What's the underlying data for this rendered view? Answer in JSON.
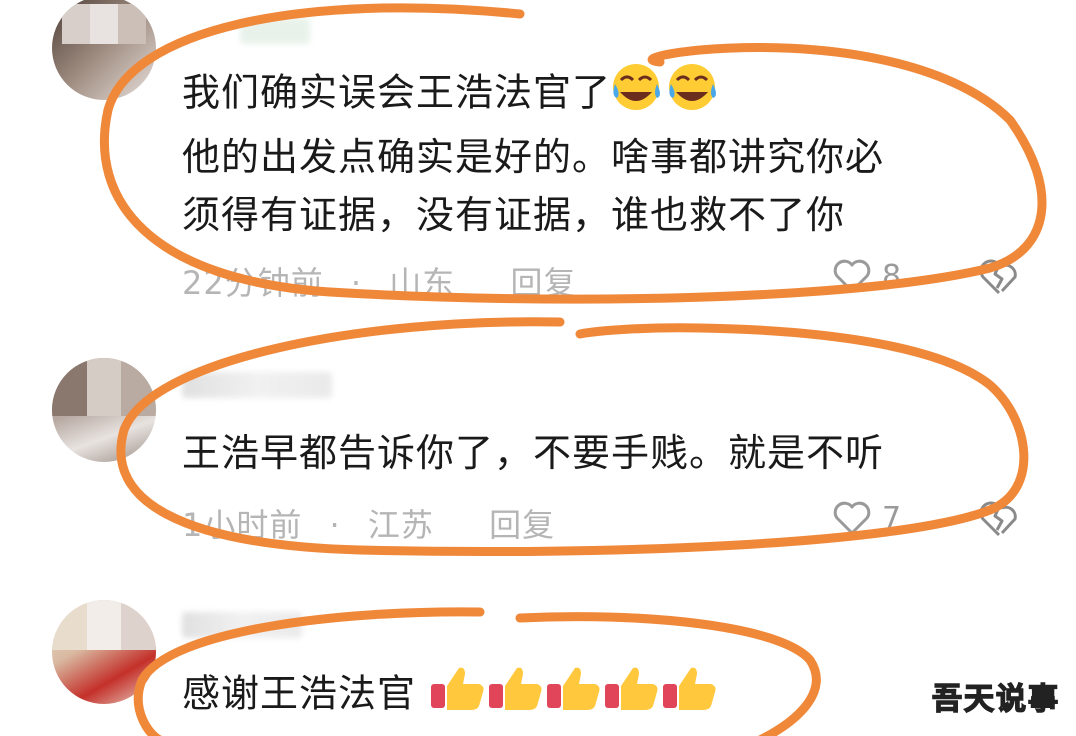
{
  "comments": [
    {
      "text_lines": [
        "我们确实误会王浩法官了",
        "他的出发点确实是好的。啥事都讲究你必",
        "须得有证据，没有证据，谁也救不了你"
      ],
      "emoji": "face-with-tears-of-joy",
      "time": "22分钟前",
      "separator": "·",
      "location": "山东",
      "reply": "回复",
      "likes": "8"
    },
    {
      "text_lines": [
        "王浩早都告诉你了，不要手贱。就是不听"
      ],
      "time": "1小时前",
      "separator": "·",
      "location": "江苏",
      "reply": "回复",
      "likes": "7"
    },
    {
      "text_lines": [
        "感谢王浩法官"
      ],
      "emoji": "thumbs-up"
    }
  ],
  "watermark": "吾天说事",
  "colors": {
    "annotation_oval": "#f0883a",
    "meta_text": "#b5b5b5",
    "body_text": "#1a1a1a"
  }
}
